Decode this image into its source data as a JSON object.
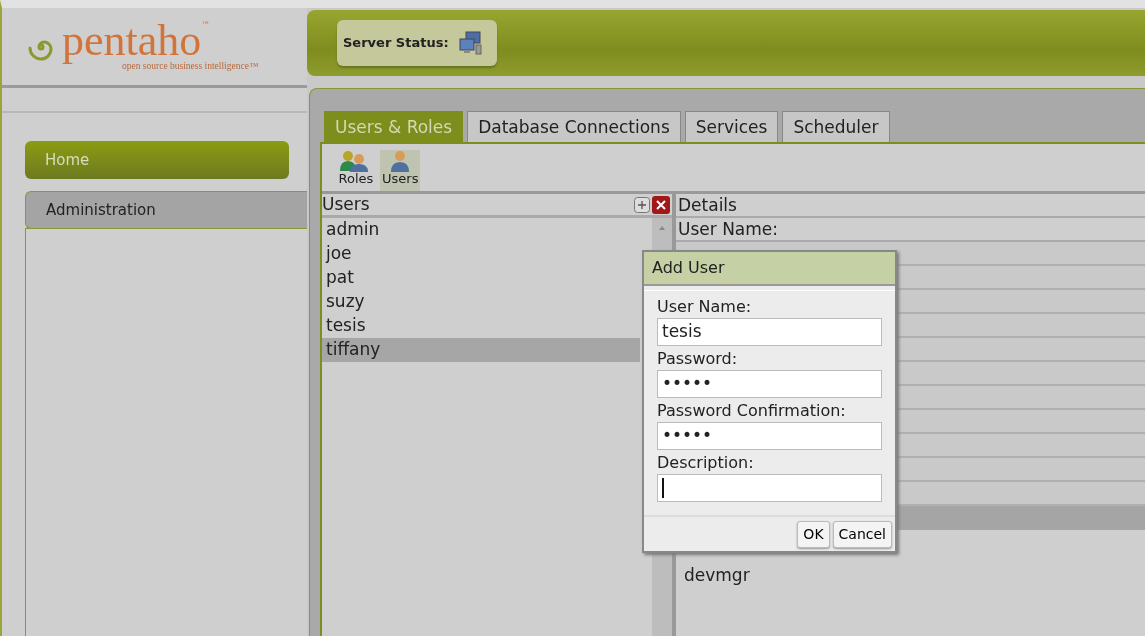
{
  "logo": {
    "wordmark": "pentaho",
    "trademark": "™",
    "tagline": "open source business intelligence™"
  },
  "server_status": {
    "label": "Server Status:"
  },
  "sidebar": {
    "items": [
      {
        "label": "Home",
        "selected": false
      },
      {
        "label": "Administration",
        "selected": true
      }
    ]
  },
  "tabs": [
    {
      "label": "Users & Roles",
      "selected": true
    },
    {
      "label": "Database Connections",
      "selected": false
    },
    {
      "label": "Services",
      "selected": false
    },
    {
      "label": "Scheduler",
      "selected": false
    }
  ],
  "toolbar": [
    {
      "label": "Roles",
      "kind": "roles",
      "selected": false
    },
    {
      "label": "Users",
      "kind": "users",
      "selected": true
    }
  ],
  "users_list": {
    "title": "Users",
    "items": [
      {
        "label": "admin",
        "selected": false
      },
      {
        "label": "joe",
        "selected": false
      },
      {
        "label": "pat",
        "selected": false
      },
      {
        "label": "suzy",
        "selected": false
      },
      {
        "label": "tesis",
        "selected": false
      },
      {
        "label": "tiffany",
        "selected": true
      }
    ]
  },
  "details": {
    "title": "Details",
    "field_label": "User Name:",
    "list_item": "devmgr"
  },
  "dialog": {
    "title": "Add User",
    "fields": [
      {
        "label": "User Name:",
        "value": "tesis",
        "focused": false
      },
      {
        "label": "Password:",
        "value": "•••••",
        "focused": false
      },
      {
        "label": "Password Confirmation:",
        "value": "•••••",
        "focused": false
      },
      {
        "label": "Description:",
        "focused": true
      }
    ],
    "buttons": [
      "OK",
      "Cancel"
    ]
  }
}
